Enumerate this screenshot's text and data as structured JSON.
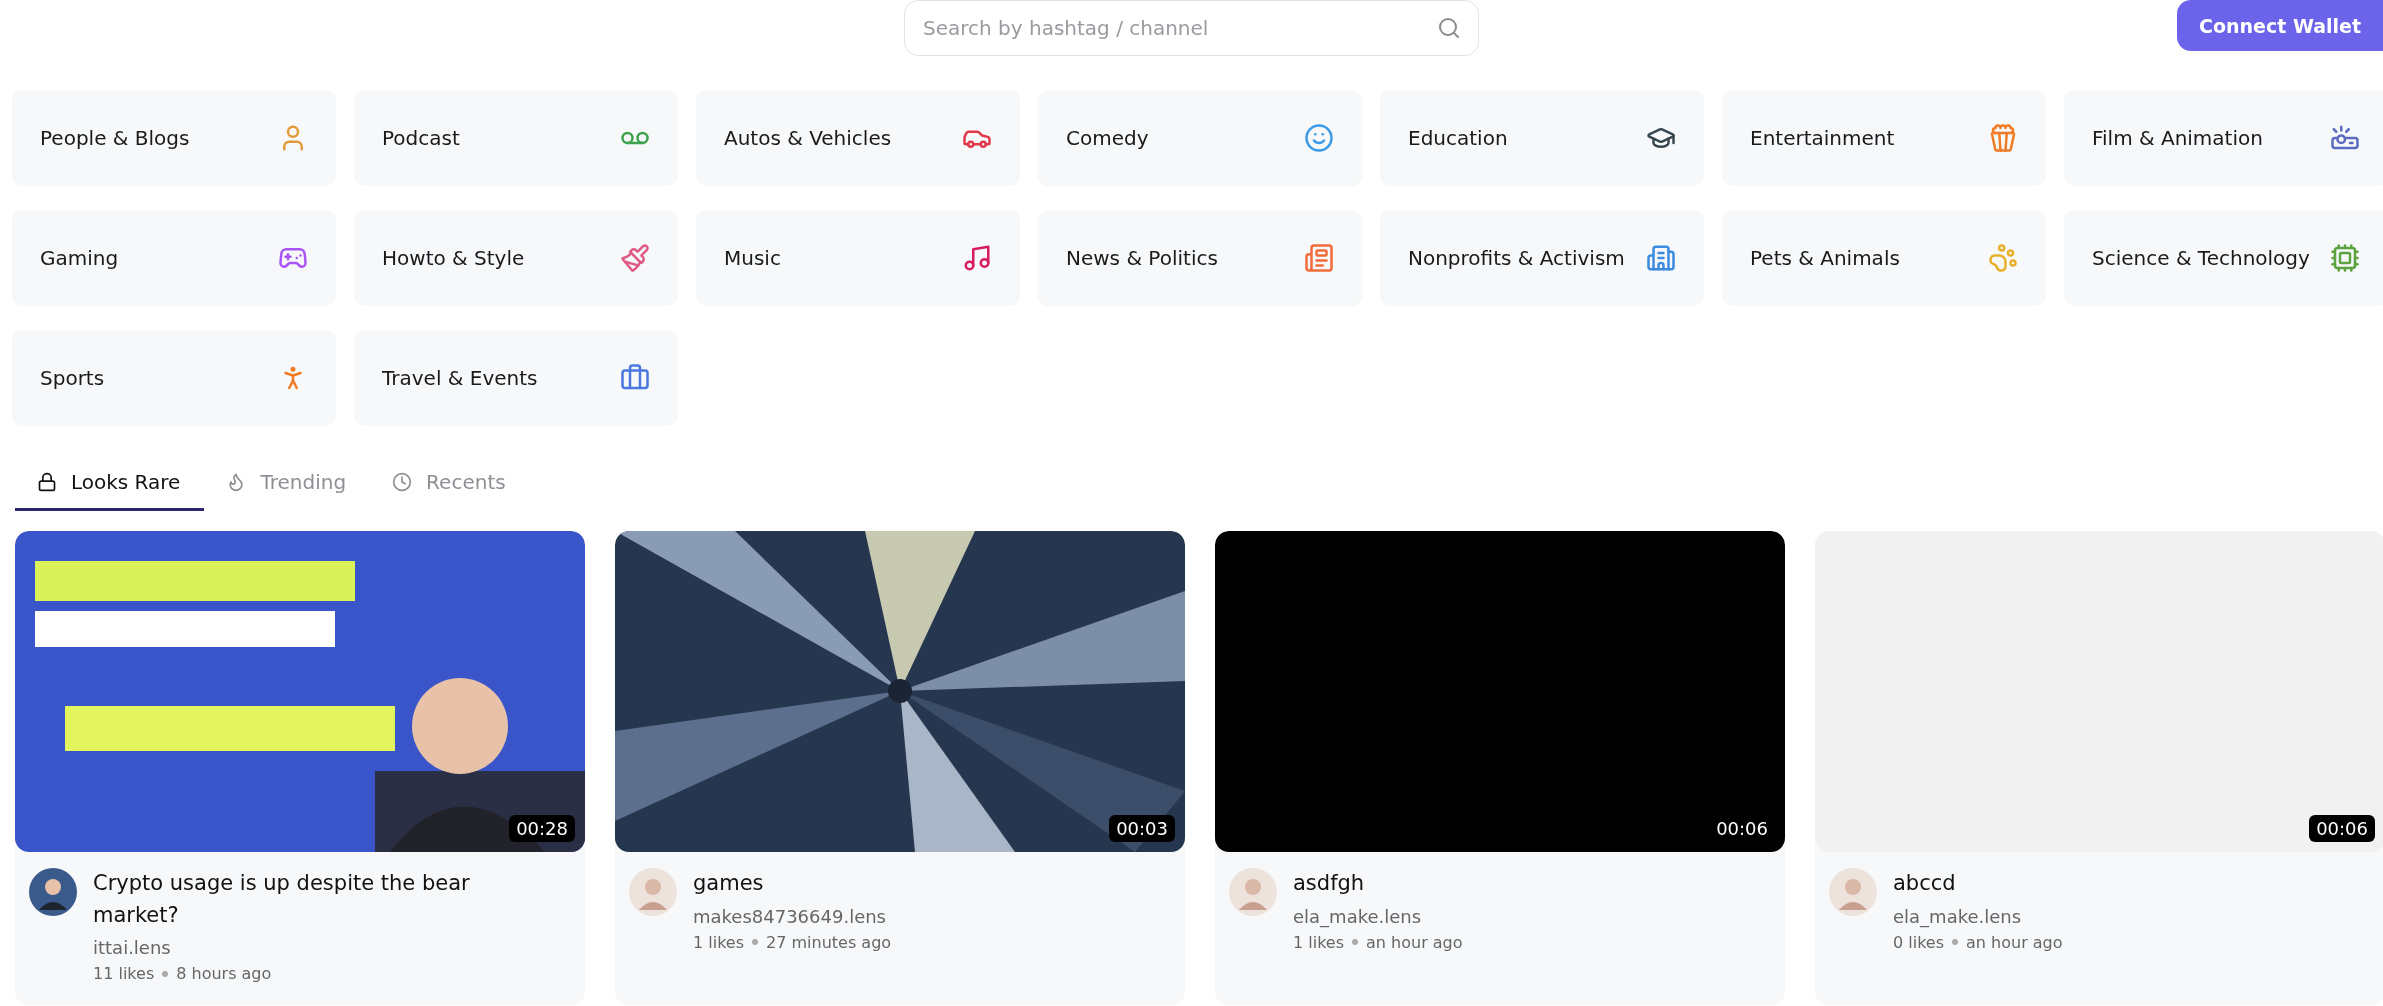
{
  "search": {
    "placeholder": "Search by hashtag / channel"
  },
  "connect_button": "Connect Wallet",
  "categories": [
    {
      "label": "People & Blogs"
    },
    {
      "label": "Podcast"
    },
    {
      "label": "Autos & Vehicles"
    },
    {
      "label": "Comedy"
    },
    {
      "label": "Education"
    },
    {
      "label": "Entertainment"
    },
    {
      "label": "Film & Animation"
    },
    {
      "label": "Gaming"
    },
    {
      "label": "Howto & Style"
    },
    {
      "label": "Music"
    },
    {
      "label": "News & Politics"
    },
    {
      "label": "Nonprofits & Activism"
    },
    {
      "label": "Pets & Animals"
    },
    {
      "label": "Science & Technology"
    },
    {
      "label": "Sports"
    },
    {
      "label": "Travel & Events"
    }
  ],
  "tabs": [
    {
      "label": "Looks Rare",
      "selected": true
    },
    {
      "label": "Trending",
      "selected": false
    },
    {
      "label": "Recents",
      "selected": false
    }
  ],
  "videos": [
    {
      "duration": "00:28",
      "title": "Crypto usage is up despite the bear market?",
      "channel": "ittai.lens",
      "likes": "11 likes",
      "time": "8 hours ago"
    },
    {
      "duration": "00:03",
      "title": "games",
      "channel": "makes84736649.lens",
      "likes": "1 likes",
      "time": "27 minutes ago"
    },
    {
      "duration": "00:06",
      "title": "asdfgh",
      "channel": "ela_make.lens",
      "likes": "1 likes",
      "time": "an hour ago"
    },
    {
      "duration": "00:06",
      "title": "abccd",
      "channel": "ela_make.lens",
      "likes": "0 likes",
      "time": "an hour ago"
    }
  ]
}
